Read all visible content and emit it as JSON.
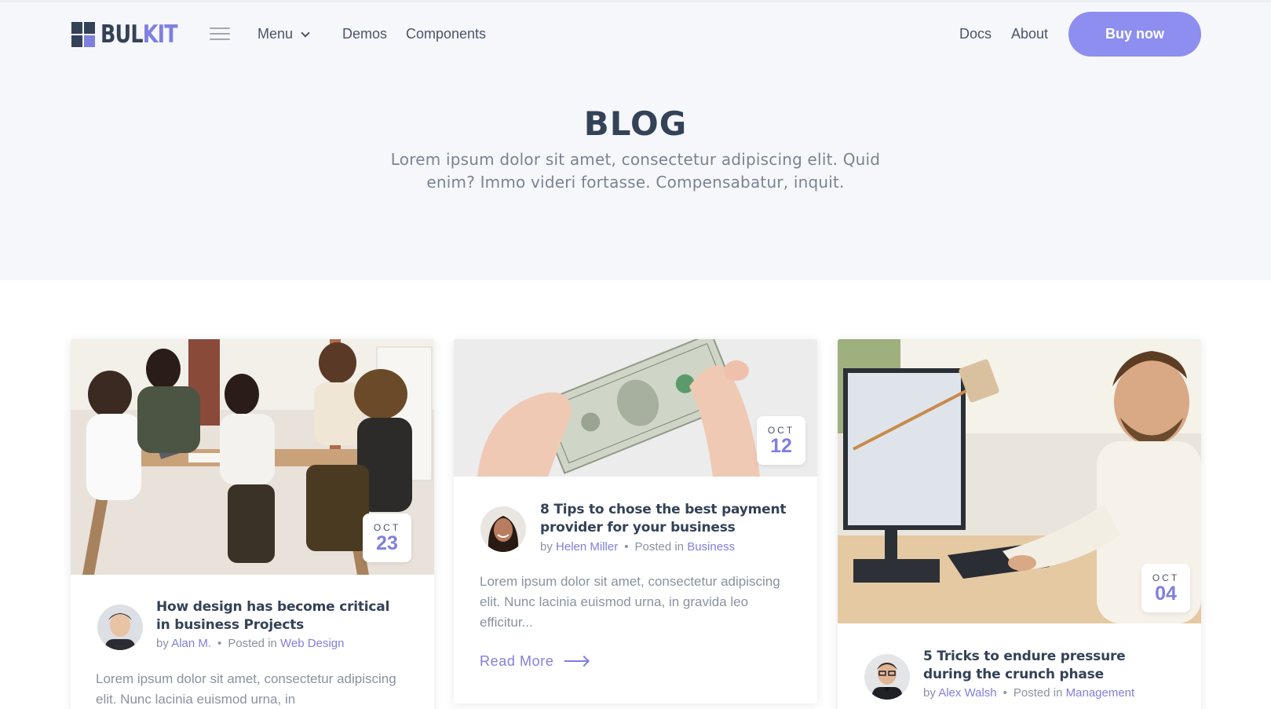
{
  "brand": {
    "logo_part1": "BUL",
    "logo_part2": "KIT",
    "accent_color": "#7f7fe0",
    "dark_color": "#344258"
  },
  "nav": {
    "menu_icon": "hamburger-icon",
    "menu_label": "Menu",
    "demos_label": "Demos",
    "components_label": "Components",
    "docs_label": "Docs",
    "about_label": "About",
    "buy_label": "Buy now"
  },
  "hero": {
    "title": "BLOG",
    "subtitle": "Lorem ipsum dolor sit amet, consectetur adipiscing elit. Quid enim? Immo videri fortasse. Compensabatur, inquit."
  },
  "posts": [
    {
      "month": "OCT",
      "day": "23",
      "title": "How design has become critical in business Projects",
      "by": "by",
      "author": "Alan M.",
      "posted_in": "Posted in",
      "category": "Web Design",
      "excerpt": "Lorem ipsum dolor sit amet, consectetur adipiscing elit. Nunc lacinia euismod urna, in"
    },
    {
      "month": "OCT",
      "day": "12",
      "title": "8 Tips to chose the best payment provider for your business",
      "by": "by",
      "author": "Helen Miller",
      "posted_in": "Posted in",
      "category": "Business",
      "excerpt": "Lorem ipsum dolor sit amet, consectetur adipiscing elit. Nunc lacinia euismod urna, in gravida leo efficitur...",
      "read_more": "Read More"
    },
    {
      "month": "OCT",
      "day": "04",
      "title": "5 Tricks to endure pressure during the crunch phase",
      "by": "by",
      "author": "Alex Walsh",
      "posted_in": "Posted in",
      "category": "Management"
    }
  ]
}
